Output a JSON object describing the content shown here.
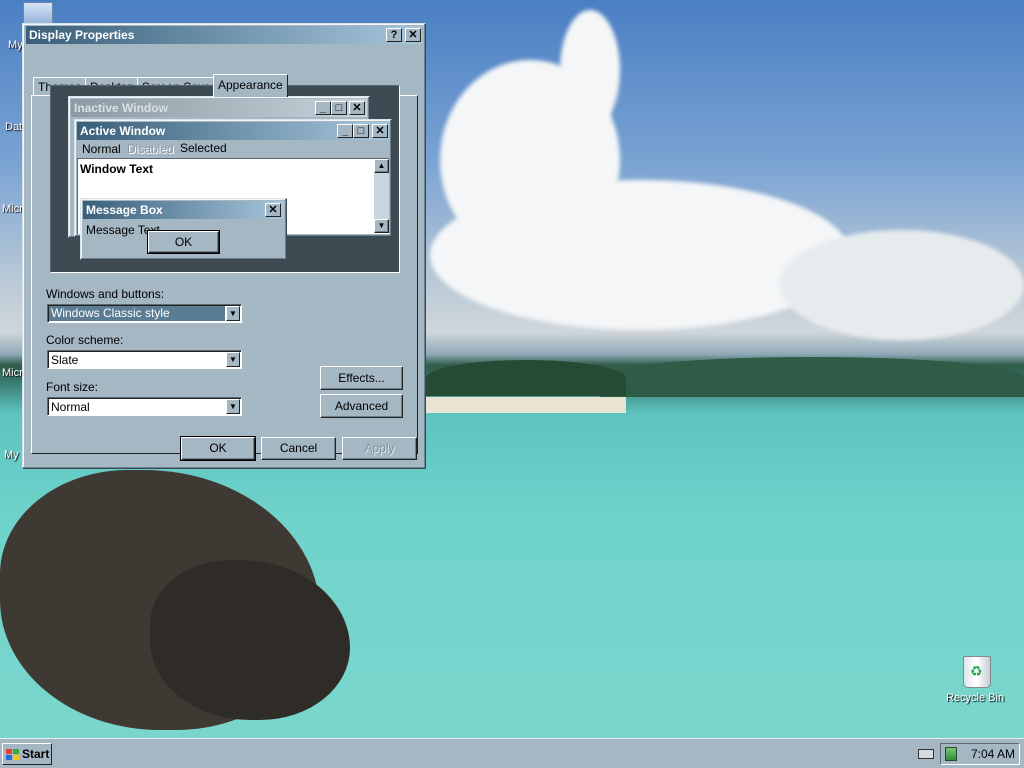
{
  "desktop": {
    "icons": [
      {
        "label": "My"
      },
      {
        "label": "Dat"
      },
      {
        "label": "Micr"
      },
      {
        "label": "Micr"
      },
      {
        "label": "My"
      }
    ],
    "recycle_bin": {
      "label": "Recycle Bin",
      "icon": "recycle-bin-icon"
    }
  },
  "dialog": {
    "title": "Display Properties",
    "help_btn": "?",
    "close_btn": "✕",
    "tabs": [
      {
        "label": "Themes"
      },
      {
        "label": "Desktop"
      },
      {
        "label": "Screen Saver"
      },
      {
        "label": "Appearance",
        "selected": true
      }
    ],
    "preview": {
      "inactive_title": "Inactive Window",
      "active_title": "Active Window",
      "menu": {
        "normal": "Normal",
        "disabled": "Disabled",
        "selected": "Selected"
      },
      "window_text": "Window Text",
      "msgbox_title": "Message Box",
      "msgbox_text": "Message Text",
      "msgbox_ok": "OK",
      "min_btn": "_",
      "max_btn": "□",
      "close_btn": "✕"
    },
    "windows_buttons": {
      "label": "Windows and buttons:",
      "value": "Windows Classic style"
    },
    "color_scheme": {
      "label": "Color scheme:",
      "value": "Slate"
    },
    "font_size": {
      "label": "Font size:",
      "value": "Normal"
    },
    "effects_btn": "Effects...",
    "advanced_btn": "Advanced",
    "ok_btn": "OK",
    "cancel_btn": "Cancel",
    "apply_btn": "Apply"
  },
  "taskbar": {
    "start_label": "Start",
    "clock": "7:04 AM"
  },
  "colors": {
    "face": "#a4b7c3",
    "title_active_start": "#3a5f7a",
    "title_active_end": "#a6c6dc",
    "preview_bg": "#3f4b52"
  }
}
